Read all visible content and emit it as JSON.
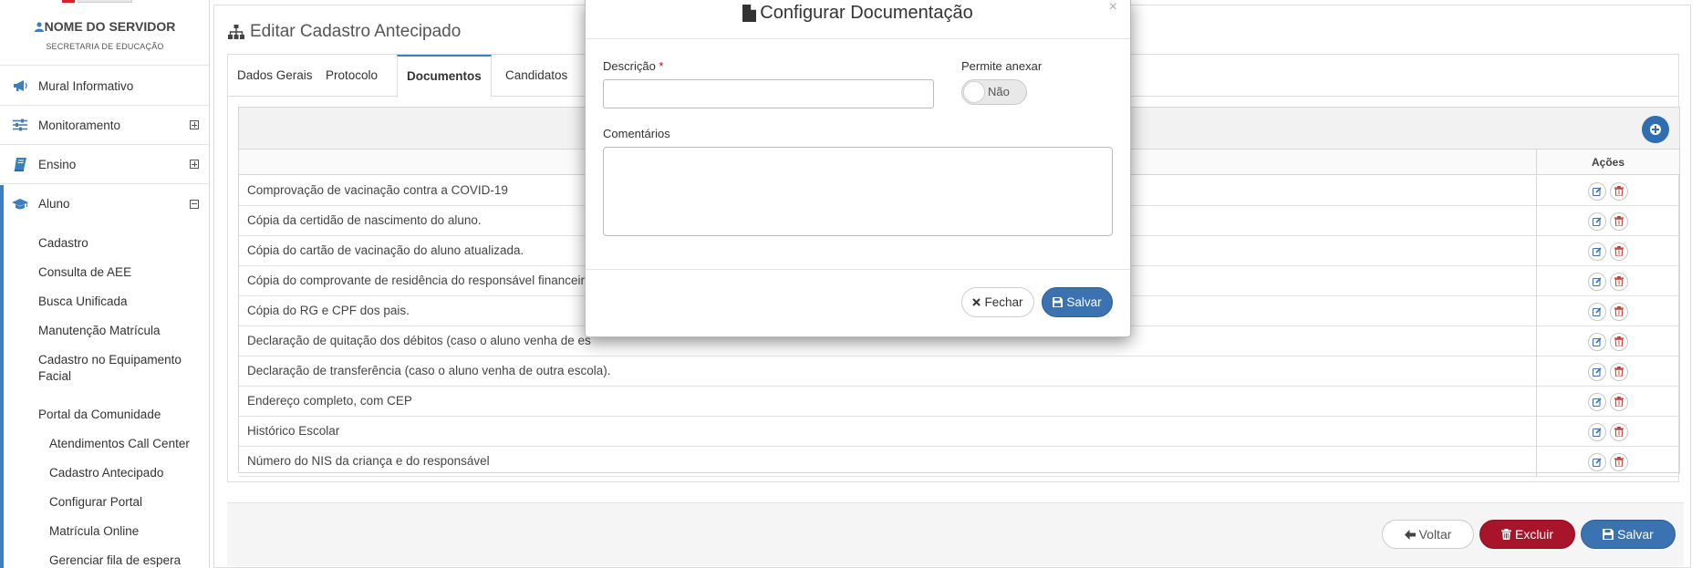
{
  "sidebar": {
    "user_name": "NOME DO SERVIDOR",
    "user_sub": "SECRETARIA DE EDUCAÇÃO",
    "items": [
      {
        "label": "Mural Informativo",
        "icon": "megaphone-icon",
        "toggle": null
      },
      {
        "label": "Monitoramento",
        "icon": "sliders-icon",
        "toggle": "plus"
      },
      {
        "label": "Ensino",
        "icon": "book-icon",
        "toggle": "plus"
      },
      {
        "label": "Aluno",
        "icon": "graduation-cap-icon",
        "toggle": "minus"
      }
    ],
    "aluno_subitems": [
      "Cadastro",
      "Consulta de AEE",
      "Busca Unificada",
      "Manutenção Matrícula",
      "Cadastro no Equipamento",
      "Facial",
      "Portal da Comunidade"
    ],
    "portal_subitems": [
      "Atendimentos Call Center",
      "Cadastro Antecipado",
      "Configurar Portal",
      "Matrícula Online",
      "Gerenciar fila de espera"
    ]
  },
  "main": {
    "title": "Editar Cadastro Antecipado",
    "tabs": [
      "Dados Gerais",
      "Protocolo",
      "Documentos",
      "Candidatos"
    ],
    "active_tab": "Documentos",
    "table": {
      "actions_header": "Ações",
      "rows": [
        "Comprovação de vacinação contra a COVID-19",
        "Cópia da certidão de nascimento do aluno.",
        "Cópia do cartão de vacinação do aluno atualizada.",
        "Cópia do comprovante de residência do responsável financeir",
        "Cópia do RG e CPF dos pais.",
        "Declaração de quitação dos débitos (caso o aluno venha de es",
        "Declaração de transferência (caso o aluno venha de outra escola).",
        "Endereço completo, com CEP",
        "Histórico Escolar",
        "Número do NIS da criança e do responsável"
      ]
    },
    "buttons": {
      "voltar": "Voltar",
      "excluir": "Excluir",
      "salvar": "Salvar"
    }
  },
  "modal": {
    "title": "Configurar Documentação",
    "close": "×",
    "descricao_label": "Descrição",
    "required_mark": "*",
    "descricao_value": "",
    "permite_label": "Permite anexar",
    "permite_value": "Não",
    "comentarios_label": "Comentários",
    "comentarios_value": "",
    "fechar": "Fechar",
    "salvar": "Salvar"
  },
  "colors": {
    "primary": "#3a72b2",
    "danger": "#a8152a",
    "accent_bar": "#3a7fc1"
  }
}
